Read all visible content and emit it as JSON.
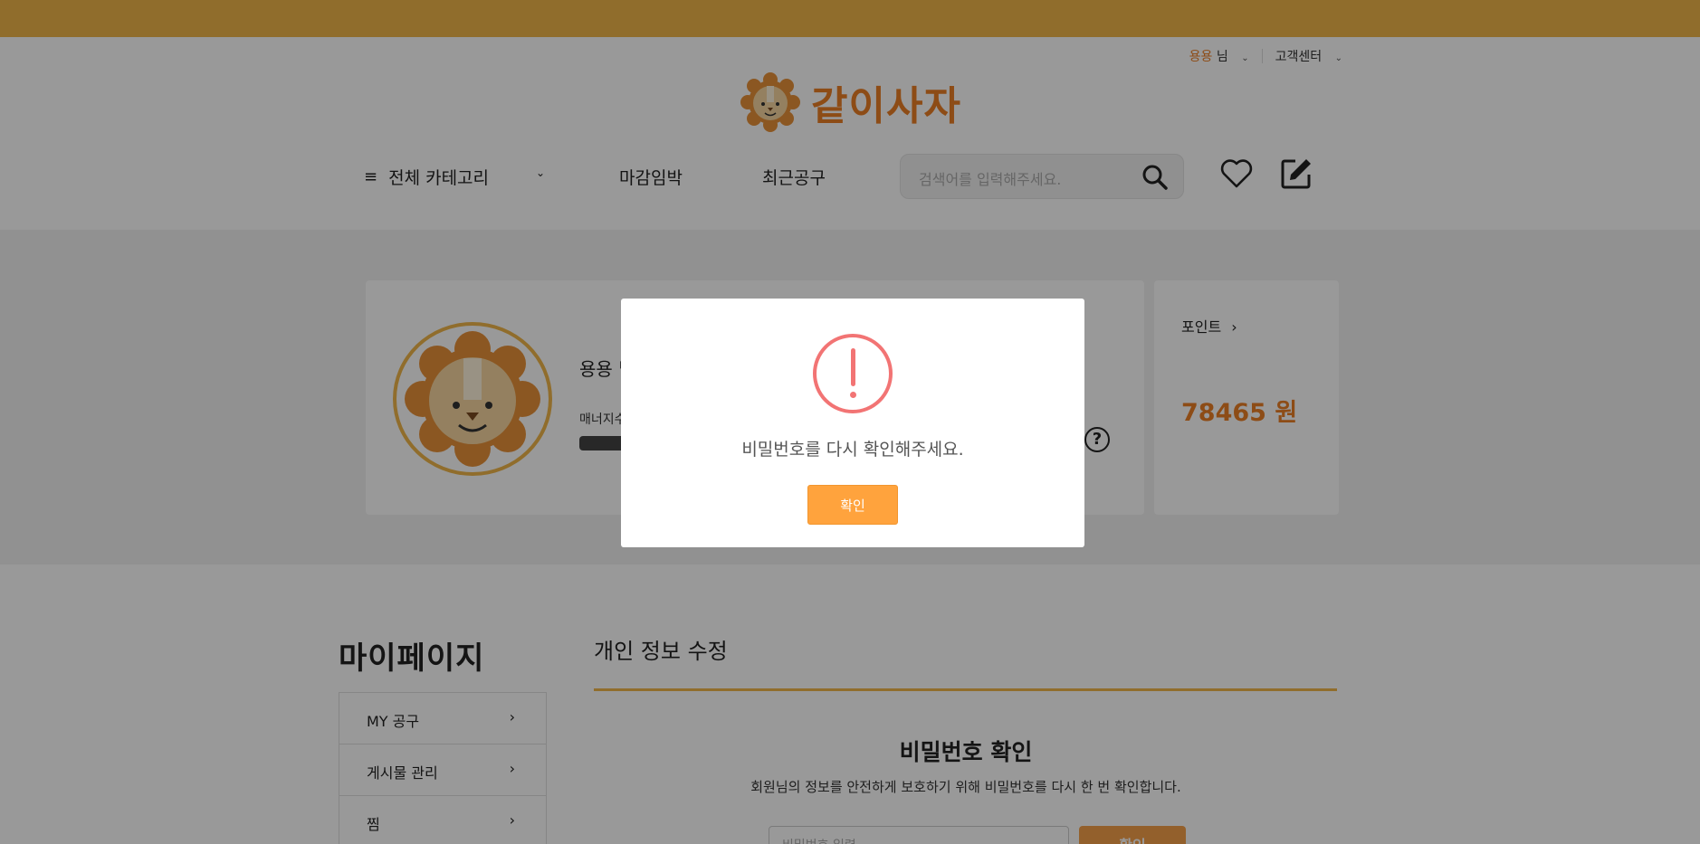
{
  "header": {
    "user_name": "용용",
    "user_suffix": "님",
    "customer_center": "고객센터",
    "logo_text": "같이사자"
  },
  "nav": {
    "category": "전체 카테고리",
    "deadline": "마감임박",
    "recent": "최근공구",
    "search_placeholder": "검색어를 입력해주세요."
  },
  "profile": {
    "name": "용용 님",
    "manner_label": "매너지수",
    "point_label": "포인트",
    "point_value": "78465 원"
  },
  "sidebar": {
    "title": "마이페이지",
    "items": [
      {
        "label": "MY 공구"
      },
      {
        "label": "게시물 관리"
      },
      {
        "label": "찜"
      }
    ]
  },
  "main": {
    "section_title": "개인 정보 수정",
    "pw_title": "비밀번호 확인",
    "pw_desc": "회원님의 정보를 안전하게 보호하기 위해 비밀번호를 다시 한 번 확인합니다.",
    "pw_placeholder": "비밀번호 입력",
    "pw_button": "확인"
  },
  "modal": {
    "message": "비밀번호를 다시 확인해주세요.",
    "ok_label": "확인"
  },
  "colors": {
    "accent": "#ec7f25",
    "brand_yellow": "#f0b64a",
    "error": "#f27474",
    "button": "#ffa33d"
  }
}
